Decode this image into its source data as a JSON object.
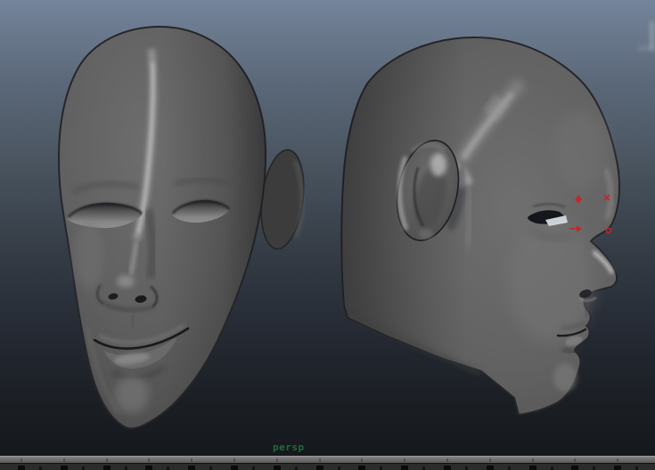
{
  "viewport": {
    "camera_label": "persp",
    "camera_label_color": "#1e6b3c",
    "background_gradient": [
      "#74849a",
      "#515c6b",
      "#343b45",
      "#1b1f24",
      "#141619"
    ]
  },
  "scene": {
    "objects": [
      {
        "id": "head-front-view",
        "label": "gray polygon head model, front three-quarter view"
      },
      {
        "id": "head-side-view",
        "label": "gray polygon head model, right profile view"
      }
    ],
    "component_markers": {
      "color": "#c1272d",
      "shapes": [
        "diamond",
        "cross",
        "arrow",
        "circle"
      ]
    }
  },
  "timeline": {
    "bar_top_color": "#828282",
    "bar_bottom_color": "#5a5a5a",
    "ruler_color": "#2c2c2d",
    "tick_color": "#0b0b0b"
  }
}
